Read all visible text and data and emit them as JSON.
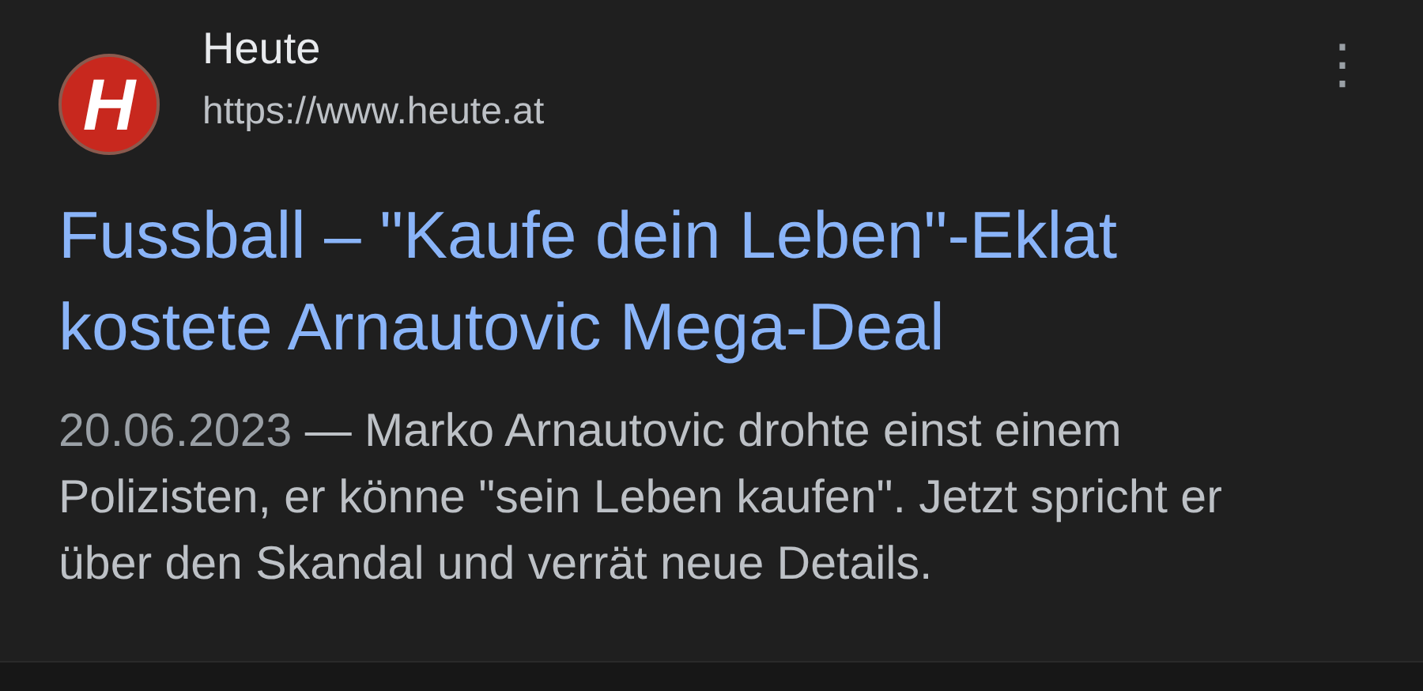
{
  "result": {
    "logo_letter": "H",
    "site_name": "Heute",
    "url": "https://www.heute.at",
    "menu_icon": "⋮",
    "title_lines": [
      "Fussball – \"Kaufe dein Leben\"-Eklat",
      "kostete Arnautovic Mega-Deal"
    ],
    "date": "20.06.2023",
    "snippet": "— Marko Arnautovic drohte einst einem Polizisten, er könne \"sein Leben kaufen\". Jetzt spricht er über den Skandal und verrät neue Details."
  }
}
